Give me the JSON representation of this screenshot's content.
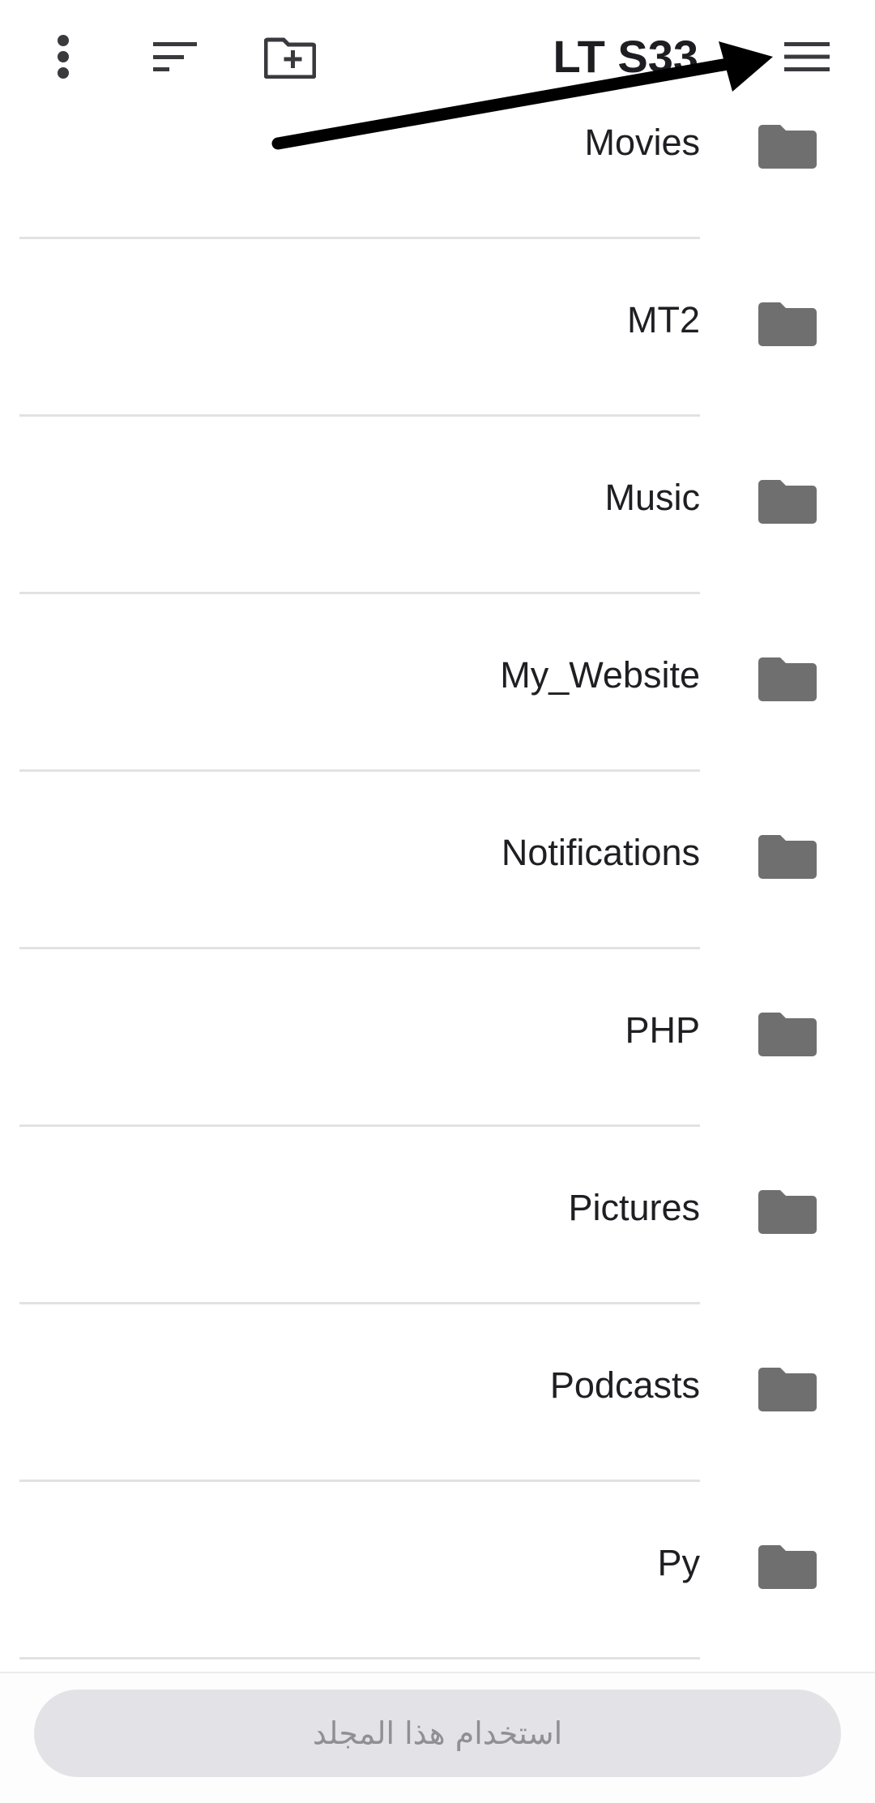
{
  "toolbar": {
    "title": "LT S33",
    "icons": {
      "overflow": "more-vert-icon",
      "sort": "sort-icon",
      "new_folder": "create-new-folder-icon",
      "menu": "hamburger-menu-icon"
    }
  },
  "folders": [
    {
      "name": "Movies"
    },
    {
      "name": "MT2"
    },
    {
      "name": "Music"
    },
    {
      "name": "My_Website"
    },
    {
      "name": "Notifications"
    },
    {
      "name": "PHP"
    },
    {
      "name": "Pictures"
    },
    {
      "name": "Podcasts"
    },
    {
      "name": "Py"
    }
  ],
  "bottom": {
    "use_folder_label": "استخدام هذا المجلد"
  },
  "colors": {
    "folder_icon": "#6f6f6f",
    "divider": "#e2e2e4",
    "button_bg": "#e3e3e7",
    "button_text": "#8f8f94",
    "annotation_arrow": "#000000"
  }
}
